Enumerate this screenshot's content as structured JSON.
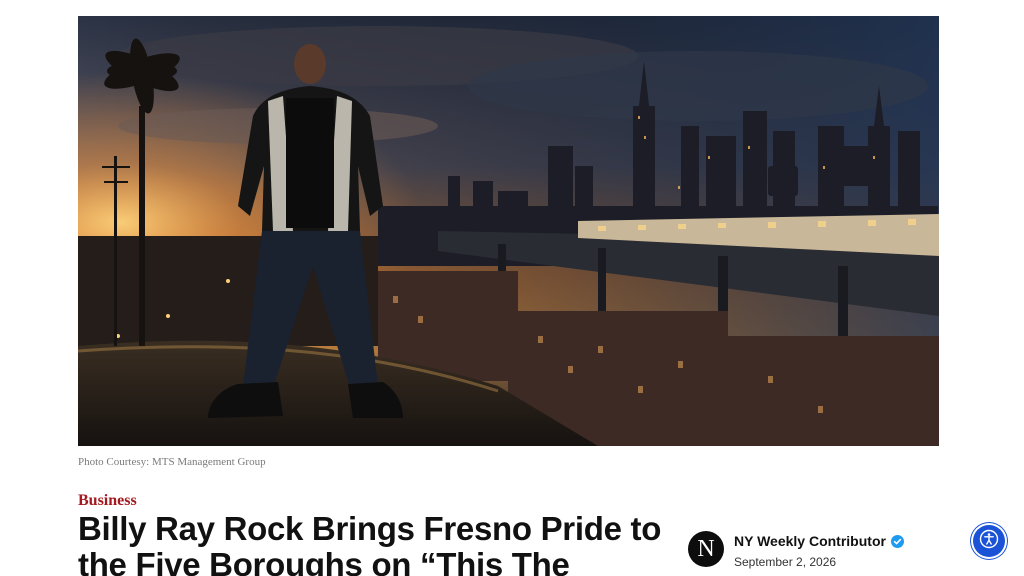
{
  "hero": {
    "alt": "Man in a leather jacket standing on a hill above a city skyline at sunset with an elevated train",
    "caption": "Photo Courtesy: MTS Management Group"
  },
  "article": {
    "category": "Business",
    "headline": "Billy Ray Rock Brings Fresno Pride to the Five Boroughs on “This The"
  },
  "author": {
    "avatar_letter": "N",
    "name": "NY Weekly Contributor",
    "date": "September 2, 2026",
    "verified_icon": "verified-check-icon"
  },
  "accessibility": {
    "icon": "accessibility-icon"
  },
  "colors": {
    "category": "#a2191f",
    "accessibility": "#1b53d6",
    "verified": "#1d9bf0"
  }
}
